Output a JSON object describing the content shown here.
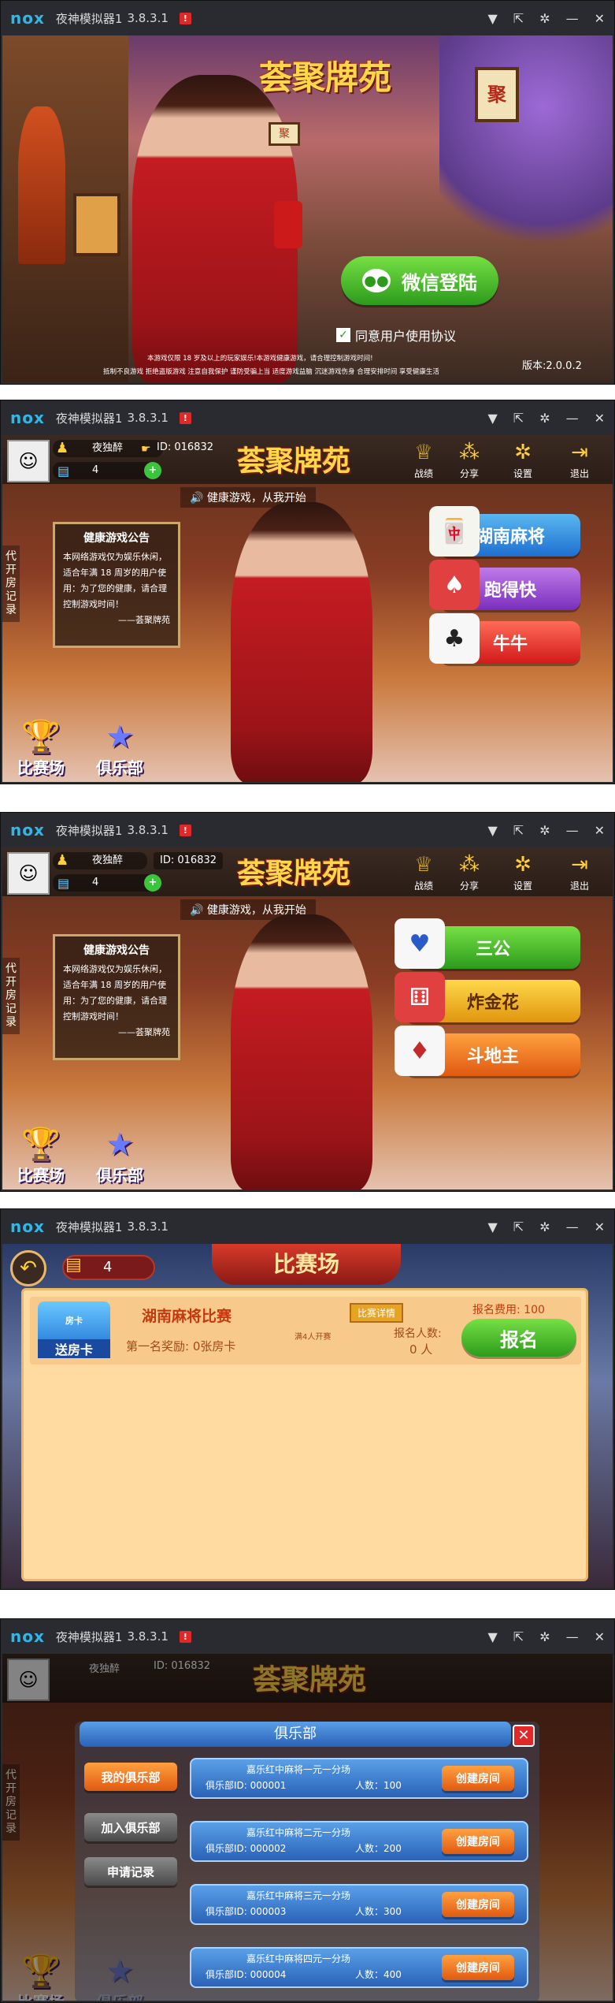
{
  "app": {
    "title": "夜神模拟器1",
    "version_s1": "3.8.3.1",
    "version_other": "3.8.3.1",
    "logo": "nox",
    "warn": "!"
  },
  "window_buttons": [
    "▼",
    "⇱",
    "✲",
    "—",
    "✕"
  ],
  "s1": {
    "banner": "荟聚牌苑",
    "lantern": "聚",
    "lantern2": "聚",
    "wechat_login": "微信登陆",
    "agree": "同意用户使用协议",
    "version": "版本:2.0.0.2",
    "disclaimer1": "本游戏仅限 18 岁及以上的玩家娱乐!本游戏健康游戏，请合理控制游戏时间!",
    "disclaimer2": "抵制不良游戏 拒绝盗版游戏 注意自我保护 谨防受骗上当 适度游戏益脑 沉迷游戏伤身 合理安排时间 享受健康生活"
  },
  "lobby": {
    "name": "夜独醉",
    "id": "ID: 016832",
    "id_label": "ID:",
    "id_value": "016832",
    "cards": "4",
    "plus": "+",
    "banner": "荟聚牌苑",
    "top_icons": [
      "战绩",
      "分享",
      "设置",
      "退出"
    ],
    "slogan": "健康游戏，从我开始",
    "notice_title": "健康游戏公告",
    "notice_body": "本网络游戏仅为娱乐休闲，适合年满 18 周岁的用户使用：为了您的健康，请合理控制游戏时间！",
    "notice_sign": "——荟聚牌苑",
    "side_label": "代开房记录",
    "match": "比赛场",
    "club": "俱乐部"
  },
  "s2": {
    "games": [
      "湖南麻将",
      "跑得快",
      "牛牛"
    ]
  },
  "s3": {
    "games": [
      "三公",
      "炸金花",
      "斗地主"
    ]
  },
  "s4": {
    "back": "↶",
    "cards": "4",
    "title": "比赛场",
    "match_name": "湖南麻将比赛",
    "room_card_label": "送房卡",
    "room_card_top": "房卡",
    "details": "比赛详情",
    "start_cond": "满4人开赛",
    "prize": "第一名奖励: 0张房卡",
    "fee": "报名费用: 100",
    "count_label": "报名人数:",
    "count_value": "0 人",
    "signup": "报名"
  },
  "s5": {
    "title": "俱乐部",
    "close": "✕",
    "side_buttons": [
      "我的俱乐部",
      "加入俱乐部",
      "申请记录"
    ],
    "clubs": [
      {
        "name": "嘉乐红中麻将一元一分场",
        "club_id": "俱乐部ID: 000001",
        "people": "人数：100",
        "action": "创建房间"
      },
      {
        "name": "嘉乐红中麻将二元一分场",
        "club_id": "俱乐部ID: 000002",
        "people": "人数：200",
        "action": "创建房间"
      },
      {
        "name": "嘉乐红中麻将三元一分场",
        "club_id": "俱乐部ID: 000003",
        "people": "人数：300",
        "action": "创建房间"
      },
      {
        "name": "嘉乐红中麻将四元一分场",
        "club_id": "俱乐部ID: 000004",
        "people": "人数：400",
        "action": "创建房间"
      }
    ]
  },
  "colors": {
    "accent": "#2fb7e8",
    "gold": "#ffd84a",
    "panel": "#ffdba1",
    "titlebar": "#2a2b30"
  }
}
